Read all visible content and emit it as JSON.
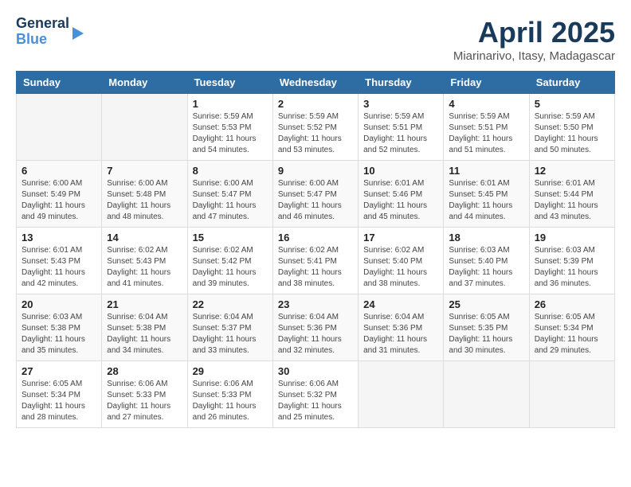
{
  "header": {
    "logo_line1": "General",
    "logo_line2": "Blue",
    "month_title": "April 2025",
    "location": "Miarinarivo, Itasy, Madagascar"
  },
  "weekdays": [
    "Sunday",
    "Monday",
    "Tuesday",
    "Wednesday",
    "Thursday",
    "Friday",
    "Saturday"
  ],
  "weeks": [
    [
      {
        "day": "",
        "info": ""
      },
      {
        "day": "",
        "info": ""
      },
      {
        "day": "1",
        "info": "Sunrise: 5:59 AM\nSunset: 5:53 PM\nDaylight: 11 hours and 54 minutes."
      },
      {
        "day": "2",
        "info": "Sunrise: 5:59 AM\nSunset: 5:52 PM\nDaylight: 11 hours and 53 minutes."
      },
      {
        "day": "3",
        "info": "Sunrise: 5:59 AM\nSunset: 5:51 PM\nDaylight: 11 hours and 52 minutes."
      },
      {
        "day": "4",
        "info": "Sunrise: 5:59 AM\nSunset: 5:51 PM\nDaylight: 11 hours and 51 minutes."
      },
      {
        "day": "5",
        "info": "Sunrise: 5:59 AM\nSunset: 5:50 PM\nDaylight: 11 hours and 50 minutes."
      }
    ],
    [
      {
        "day": "6",
        "info": "Sunrise: 6:00 AM\nSunset: 5:49 PM\nDaylight: 11 hours and 49 minutes."
      },
      {
        "day": "7",
        "info": "Sunrise: 6:00 AM\nSunset: 5:48 PM\nDaylight: 11 hours and 48 minutes."
      },
      {
        "day": "8",
        "info": "Sunrise: 6:00 AM\nSunset: 5:47 PM\nDaylight: 11 hours and 47 minutes."
      },
      {
        "day": "9",
        "info": "Sunrise: 6:00 AM\nSunset: 5:47 PM\nDaylight: 11 hours and 46 minutes."
      },
      {
        "day": "10",
        "info": "Sunrise: 6:01 AM\nSunset: 5:46 PM\nDaylight: 11 hours and 45 minutes."
      },
      {
        "day": "11",
        "info": "Sunrise: 6:01 AM\nSunset: 5:45 PM\nDaylight: 11 hours and 44 minutes."
      },
      {
        "day": "12",
        "info": "Sunrise: 6:01 AM\nSunset: 5:44 PM\nDaylight: 11 hours and 43 minutes."
      }
    ],
    [
      {
        "day": "13",
        "info": "Sunrise: 6:01 AM\nSunset: 5:43 PM\nDaylight: 11 hours and 42 minutes."
      },
      {
        "day": "14",
        "info": "Sunrise: 6:02 AM\nSunset: 5:43 PM\nDaylight: 11 hours and 41 minutes."
      },
      {
        "day": "15",
        "info": "Sunrise: 6:02 AM\nSunset: 5:42 PM\nDaylight: 11 hours and 39 minutes."
      },
      {
        "day": "16",
        "info": "Sunrise: 6:02 AM\nSunset: 5:41 PM\nDaylight: 11 hours and 38 minutes."
      },
      {
        "day": "17",
        "info": "Sunrise: 6:02 AM\nSunset: 5:40 PM\nDaylight: 11 hours and 38 minutes."
      },
      {
        "day": "18",
        "info": "Sunrise: 6:03 AM\nSunset: 5:40 PM\nDaylight: 11 hours and 37 minutes."
      },
      {
        "day": "19",
        "info": "Sunrise: 6:03 AM\nSunset: 5:39 PM\nDaylight: 11 hours and 36 minutes."
      }
    ],
    [
      {
        "day": "20",
        "info": "Sunrise: 6:03 AM\nSunset: 5:38 PM\nDaylight: 11 hours and 35 minutes."
      },
      {
        "day": "21",
        "info": "Sunrise: 6:04 AM\nSunset: 5:38 PM\nDaylight: 11 hours and 34 minutes."
      },
      {
        "day": "22",
        "info": "Sunrise: 6:04 AM\nSunset: 5:37 PM\nDaylight: 11 hours and 33 minutes."
      },
      {
        "day": "23",
        "info": "Sunrise: 6:04 AM\nSunset: 5:36 PM\nDaylight: 11 hours and 32 minutes."
      },
      {
        "day": "24",
        "info": "Sunrise: 6:04 AM\nSunset: 5:36 PM\nDaylight: 11 hours and 31 minutes."
      },
      {
        "day": "25",
        "info": "Sunrise: 6:05 AM\nSunset: 5:35 PM\nDaylight: 11 hours and 30 minutes."
      },
      {
        "day": "26",
        "info": "Sunrise: 6:05 AM\nSunset: 5:34 PM\nDaylight: 11 hours and 29 minutes."
      }
    ],
    [
      {
        "day": "27",
        "info": "Sunrise: 6:05 AM\nSunset: 5:34 PM\nDaylight: 11 hours and 28 minutes."
      },
      {
        "day": "28",
        "info": "Sunrise: 6:06 AM\nSunset: 5:33 PM\nDaylight: 11 hours and 27 minutes."
      },
      {
        "day": "29",
        "info": "Sunrise: 6:06 AM\nSunset: 5:33 PM\nDaylight: 11 hours and 26 minutes."
      },
      {
        "day": "30",
        "info": "Sunrise: 6:06 AM\nSunset: 5:32 PM\nDaylight: 11 hours and 25 minutes."
      },
      {
        "day": "",
        "info": ""
      },
      {
        "day": "",
        "info": ""
      },
      {
        "day": "",
        "info": ""
      }
    ]
  ]
}
